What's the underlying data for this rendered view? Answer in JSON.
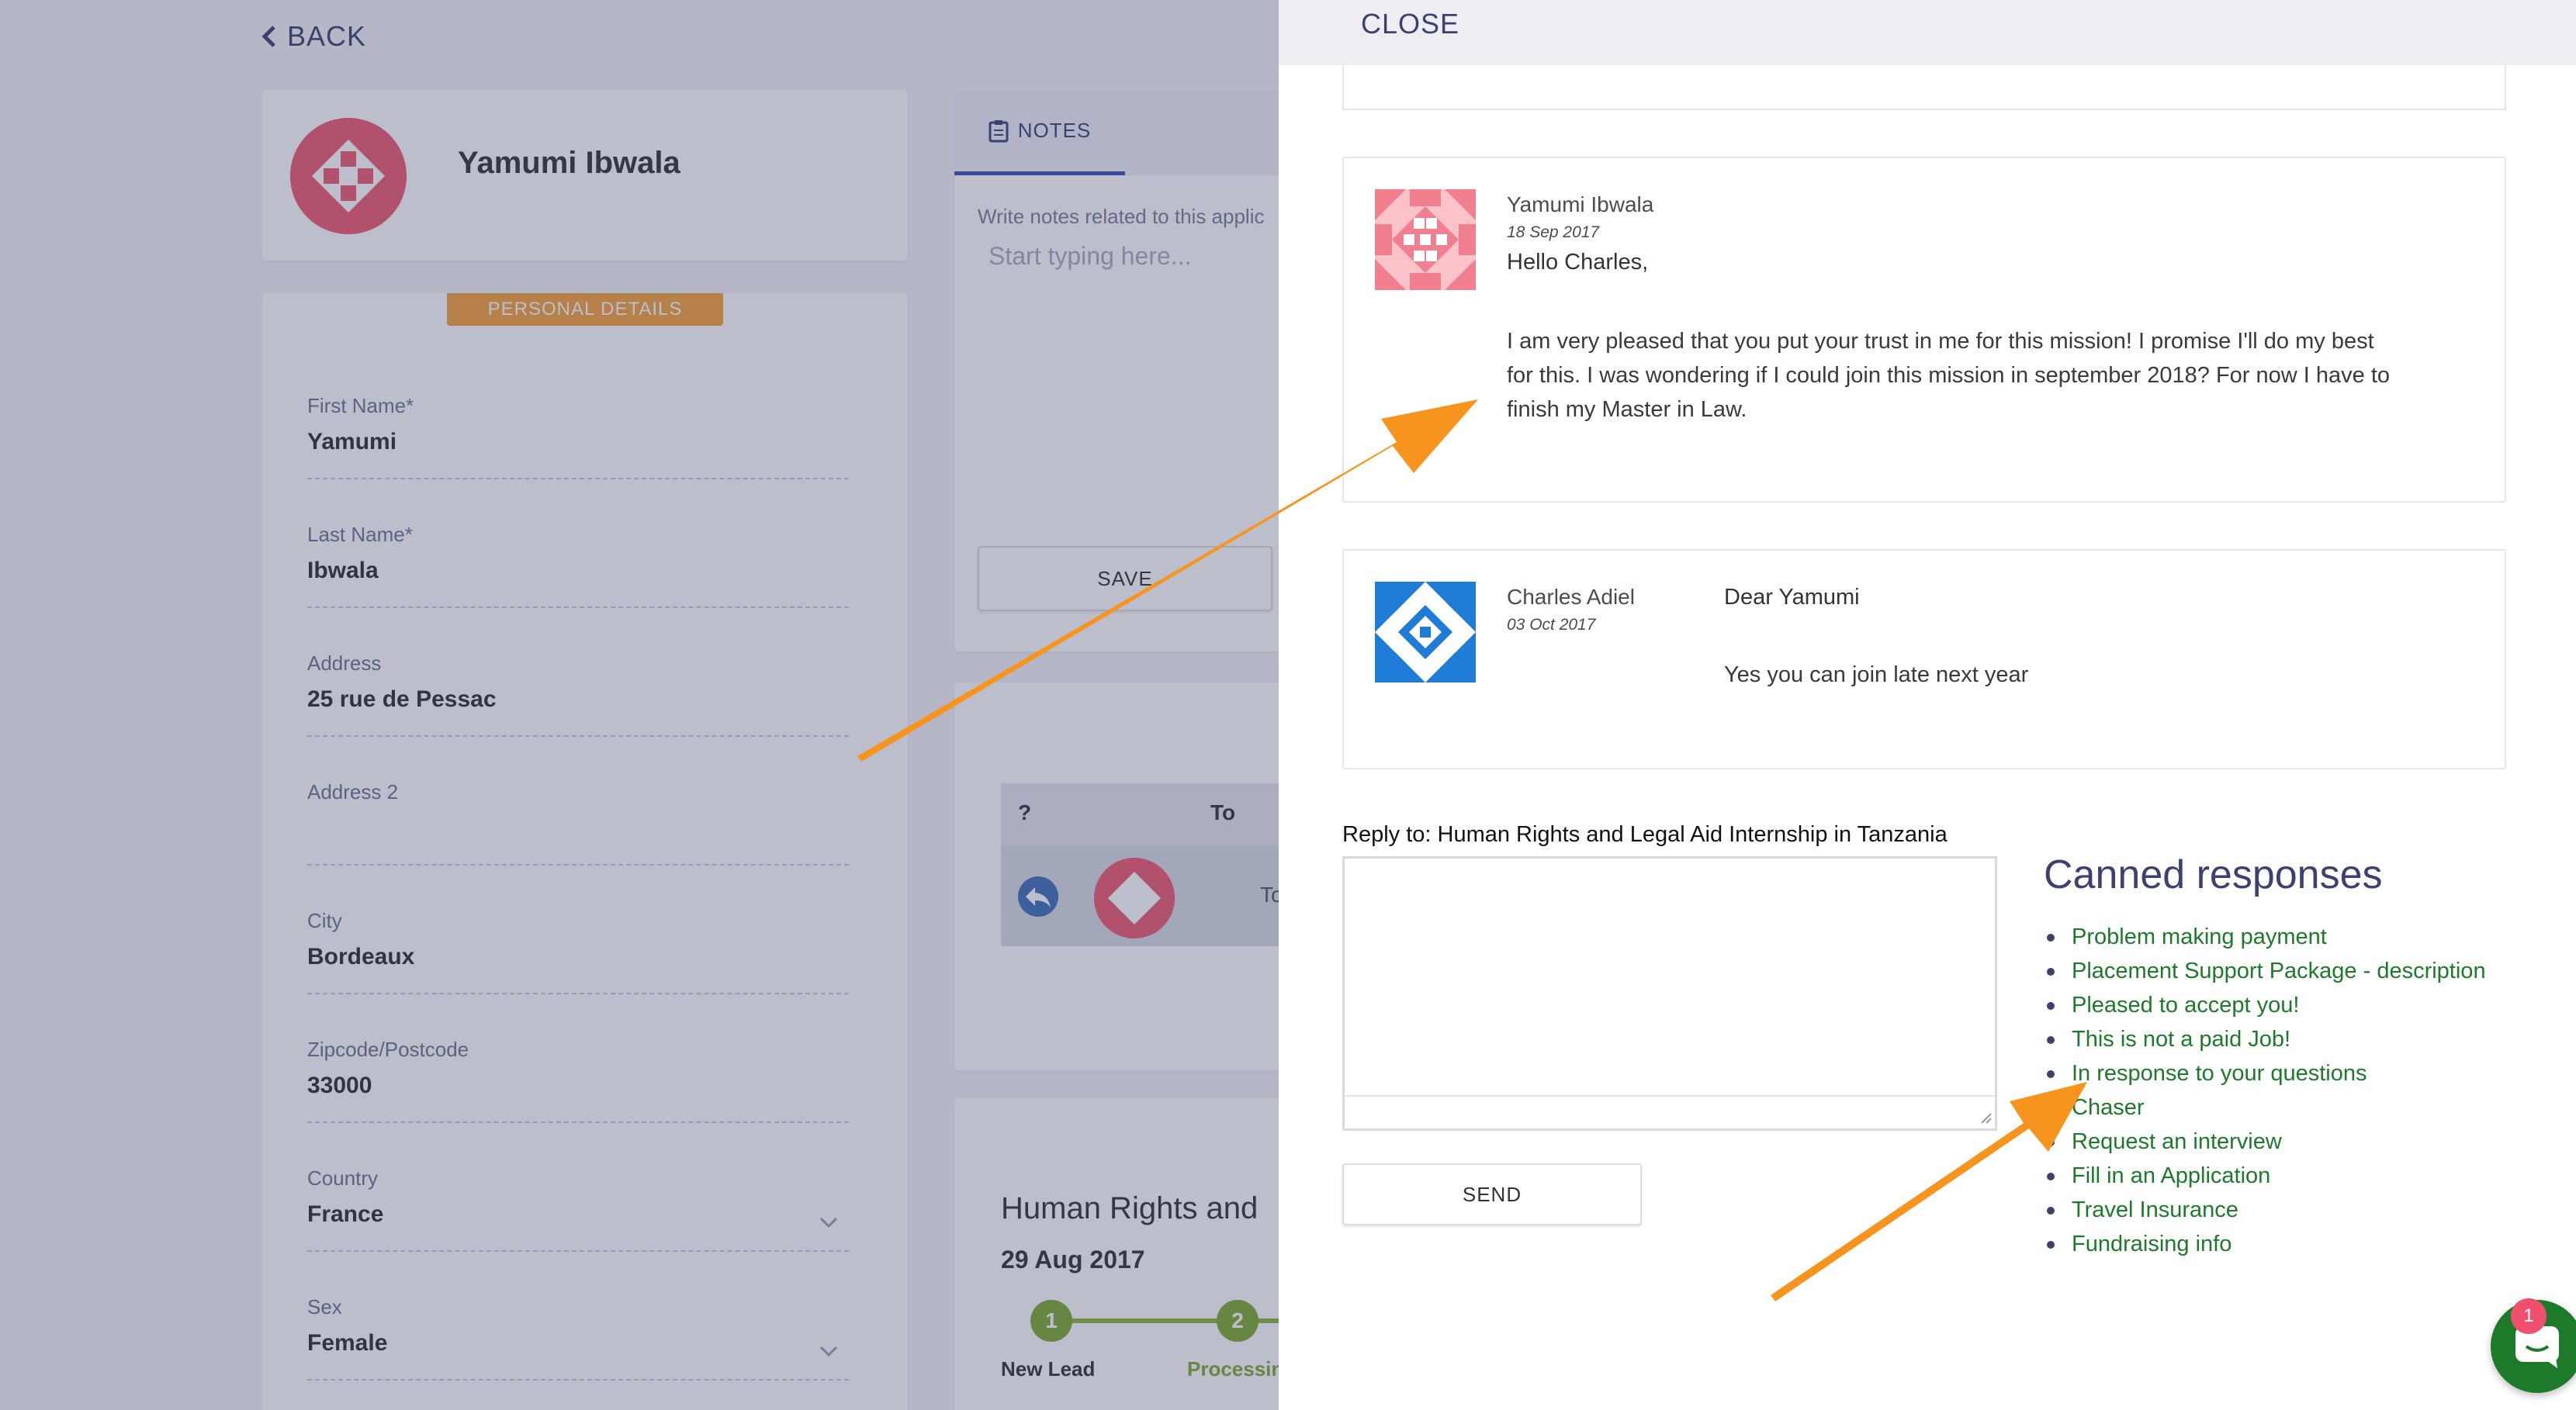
{
  "back": {
    "label": "BACK"
  },
  "profile": {
    "name": "Yamumi Ibwala"
  },
  "personal_details": {
    "badge": "PERSONAL DETAILS",
    "fields": [
      {
        "label": "First Name*",
        "value": "Yamumi"
      },
      {
        "label": "Last Name*",
        "value": "Ibwala"
      },
      {
        "label": "Address",
        "value": "25 rue de Pessac"
      },
      {
        "label": "Address 2",
        "value": ""
      },
      {
        "label": "City",
        "value": "Bordeaux"
      },
      {
        "label": "Zipcode/Postcode",
        "value": "33000"
      },
      {
        "label": "Country",
        "value": "France"
      },
      {
        "label": "Sex",
        "value": "Female"
      }
    ]
  },
  "notes": {
    "tab_label": "NOTES",
    "hint": "Write notes related to this applic",
    "placeholder": "Start typing here...",
    "save_label": "SAVE"
  },
  "messages_table": {
    "col_q": "?",
    "col_to": "To",
    "row_to": "To: Yar"
  },
  "program": {
    "title": "Human Rights and",
    "date": "29 Aug 2017",
    "steps": [
      {
        "number": "1",
        "label": "New Lead"
      },
      {
        "number": "2",
        "label": "Processin"
      }
    ]
  },
  "panel": {
    "close_label": "CLOSE",
    "messages": [
      {
        "author": "Yamumi Ibwala",
        "date": "18 Sep 2017",
        "greeting": "Hello Charles,",
        "body": "I am very pleased that you put your trust in me for this mission! I promise I'll do my best for this. I was wondering if I could join this mission in september 2018? For now I have to finish my Master in Law."
      },
      {
        "author": "Charles Adiel",
        "date": "03 Oct 2017",
        "greeting": "Dear Yamumi",
        "body": "Yes you can join late next year"
      }
    ],
    "reply_label": "Reply to: Human Rights and Legal Aid Internship in Tanzania",
    "reply_value": "",
    "send_label": "SEND",
    "canned_title": "Canned responses",
    "canned": [
      "Problem making payment",
      "Placement Support Package - description",
      "Pleased to accept you!",
      "This is not a paid Job!",
      "In response to your questions",
      "Chaser",
      "Request an interview",
      "Fill in an Application",
      "Travel Insurance",
      "Fundraising info"
    ]
  },
  "chat": {
    "badge_count": "1"
  },
  "colors": {
    "accent": "#3c4170",
    "badge_orange": "#f5a23c",
    "canned_green": "#1d7a2a",
    "annotation_arrow": "#f7941d",
    "avatar_red": "#f05a6e",
    "avatar_blue": "#1e7bd6"
  },
  "icons": [
    "chevron-left-icon",
    "clipboard-icon",
    "reply-icon",
    "chevron-down-icon",
    "chat-icon",
    "resize-grip-icon"
  ]
}
